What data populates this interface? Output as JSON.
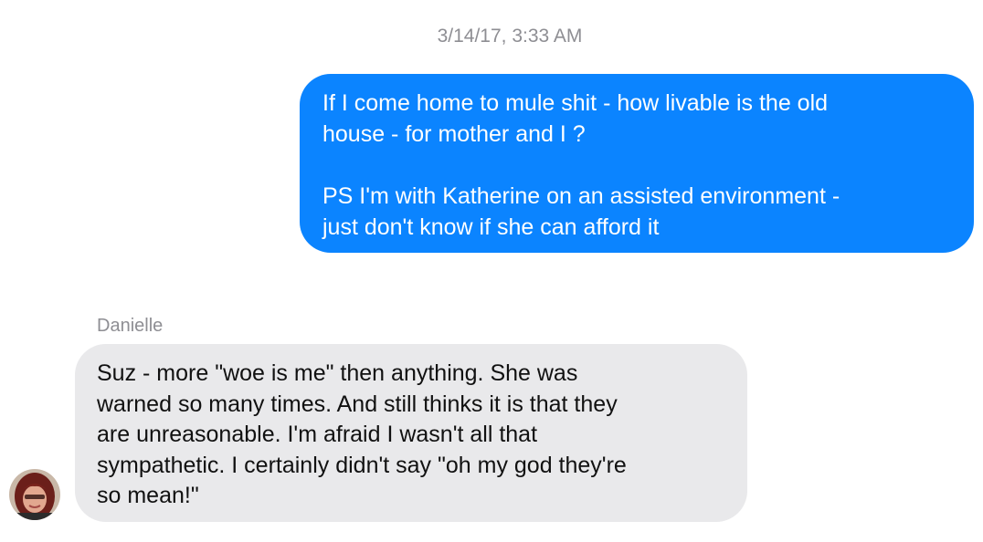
{
  "conversation": {
    "timestamp": "3/14/17, 3:33 AM",
    "messages": [
      {
        "direction": "outgoing",
        "text": "If I come home to mule shit - how livable is the old\nhouse - for mother and I ?\n\nPS I'm with Katherine on an assisted environment -\njust don't know if she can afford it"
      },
      {
        "direction": "incoming",
        "sender": "Danielle",
        "avatar_icon": "contact-avatar-photo",
        "text": "Suz - more \"woe is me\" then anything. She was\nwarned so many times. And still thinks it is that they\nare unreasonable. I'm afraid I wasn't all that\nsympathetic. I certainly didn't say \"oh my god they're\nso mean!\""
      }
    ]
  },
  "colors": {
    "outgoing_bubble": "#0b84ff",
    "incoming_bubble": "#e9e9eb",
    "meta_text": "#8e8e93"
  }
}
